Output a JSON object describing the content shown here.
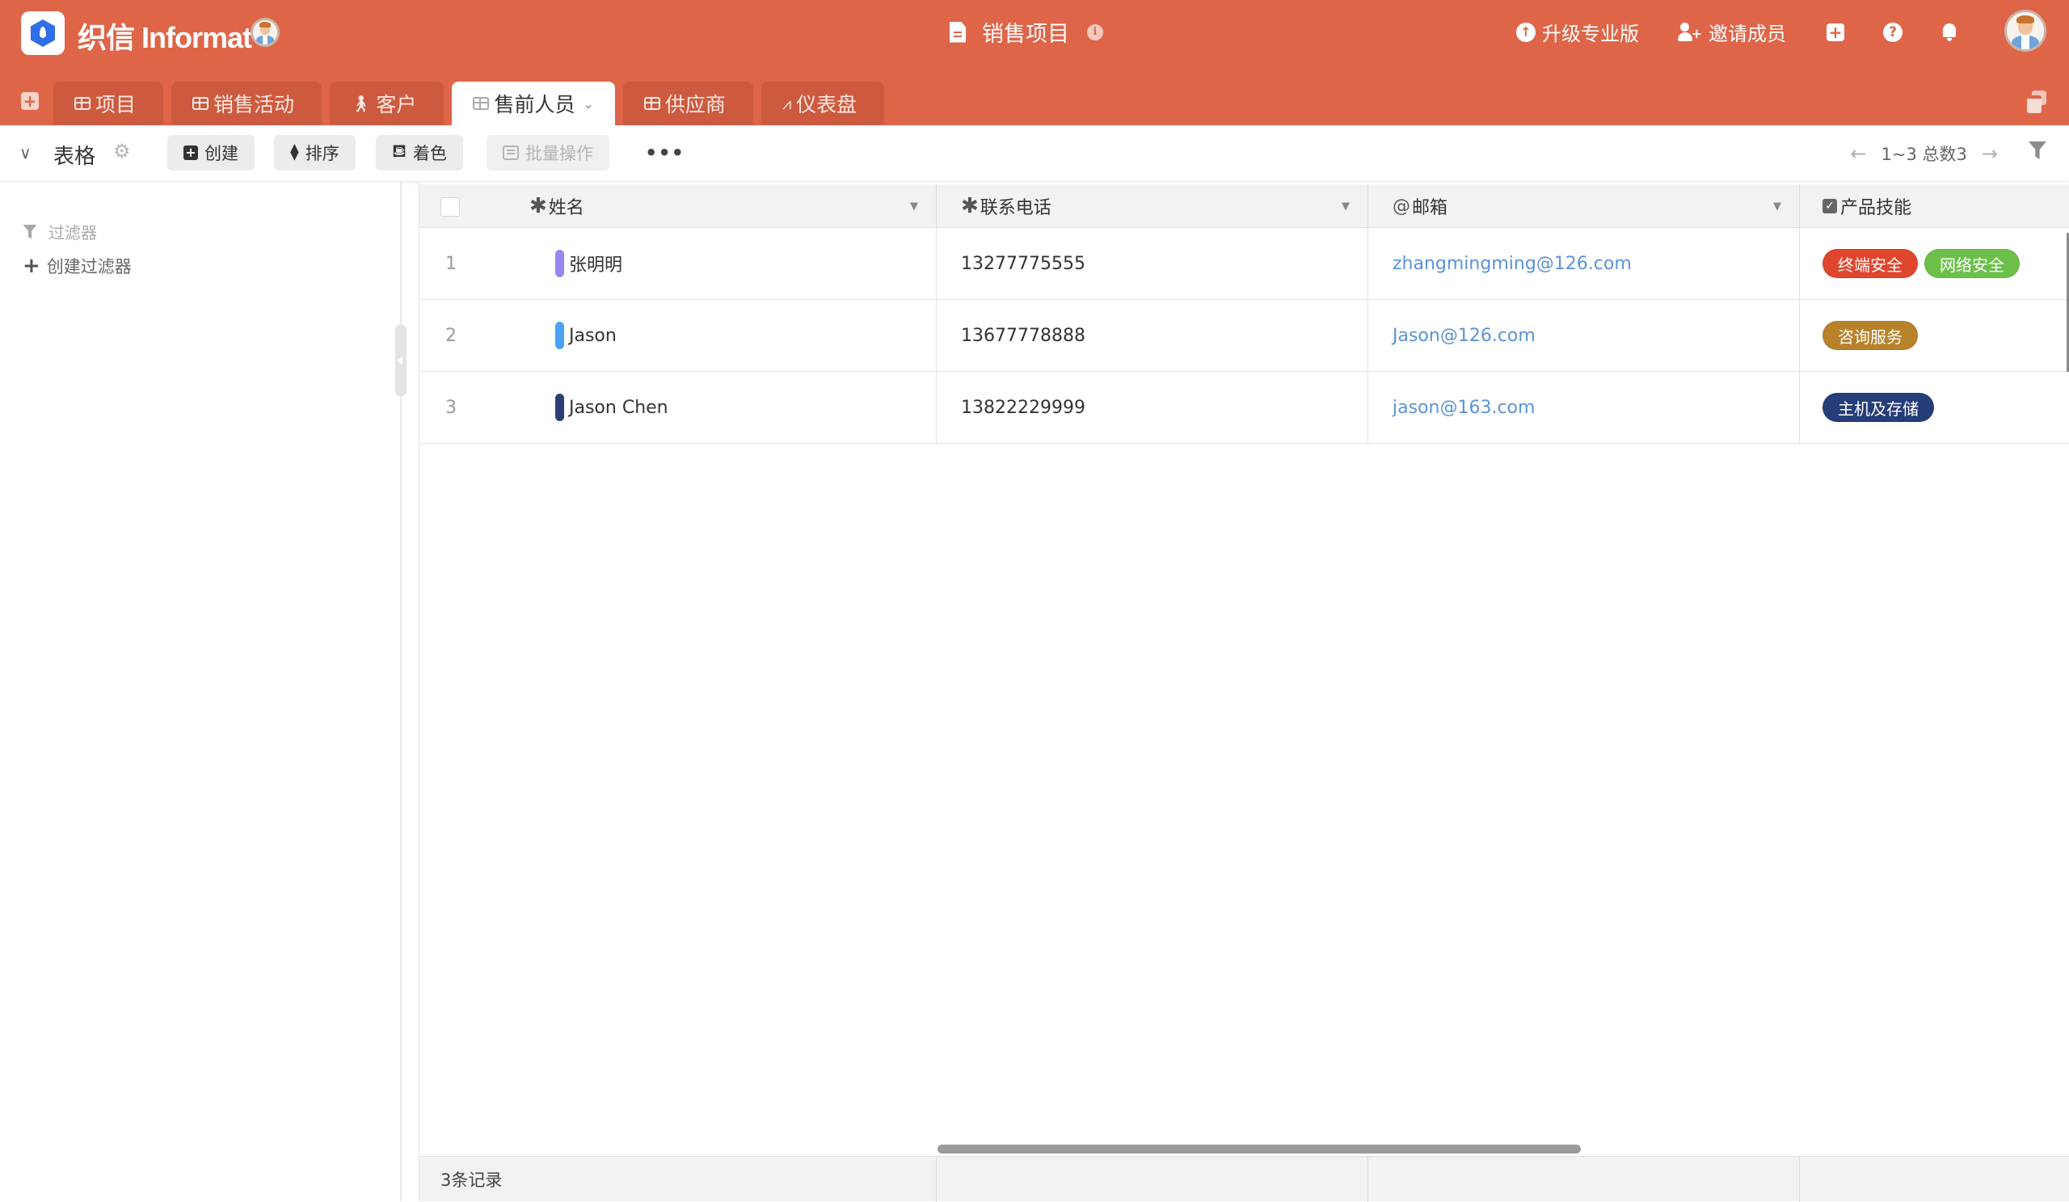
{
  "app": {
    "brand": "织信 Informat",
    "document_title": "销售项目",
    "actions": {
      "upgrade": "升级专业版",
      "invite": "邀请成员"
    }
  },
  "tabs": [
    {
      "label": "项目",
      "icon": "table-icon",
      "active": false
    },
    {
      "label": "销售活动",
      "icon": "table-icon",
      "active": false
    },
    {
      "label": "客户",
      "icon": "walking-person-icon",
      "active": false
    },
    {
      "label": "售前人员",
      "icon": "table-icon",
      "active": true
    },
    {
      "label": "供应商",
      "icon": "table-icon",
      "active": false
    },
    {
      "label": "仪表盘",
      "icon": "line-chart-icon",
      "active": false
    }
  ],
  "toolbar": {
    "view_name": "表格",
    "create": "创建",
    "sort": "排序",
    "color": "着色",
    "batch": "批量操作",
    "more": "•••",
    "pager": "1~3 总数3"
  },
  "sidebar": {
    "filter_title": "过滤器",
    "create_filter": "创建过滤器"
  },
  "table": {
    "columns": [
      {
        "label": "姓名",
        "prefix": "✱"
      },
      {
        "label": "联系电话",
        "prefix": "✱"
      },
      {
        "label": "邮箱",
        "prefix": "@"
      },
      {
        "label": "产品技能",
        "prefix": "✓"
      }
    ],
    "rows": [
      {
        "num": "1",
        "name": "张明明",
        "name_color": "#9b85f0",
        "phone": "13277775555",
        "email": "zhangmingming@126.com",
        "skills": [
          {
            "label": "终端安全",
            "color": "#e0452e"
          },
          {
            "label": "网络安全",
            "color": "#6cc04a"
          }
        ]
      },
      {
        "num": "2",
        "name": "Jason",
        "name_color": "#4aa3f5",
        "phone": "13677778888",
        "email": "Jason@126.com",
        "skills": [
          {
            "label": "咨询服务",
            "color": "#b8822a"
          }
        ]
      },
      {
        "num": "3",
        "name": "Jason Chen",
        "name_color": "#2b3f75",
        "phone": "13822229999",
        "email": "jason@163.com",
        "skills": [
          {
            "label": "主机及存储",
            "color": "#253d78"
          }
        ]
      }
    ],
    "footer": "3条记录"
  },
  "colors": {
    "header_bg": "#df6548",
    "link": "#5b93d8"
  }
}
